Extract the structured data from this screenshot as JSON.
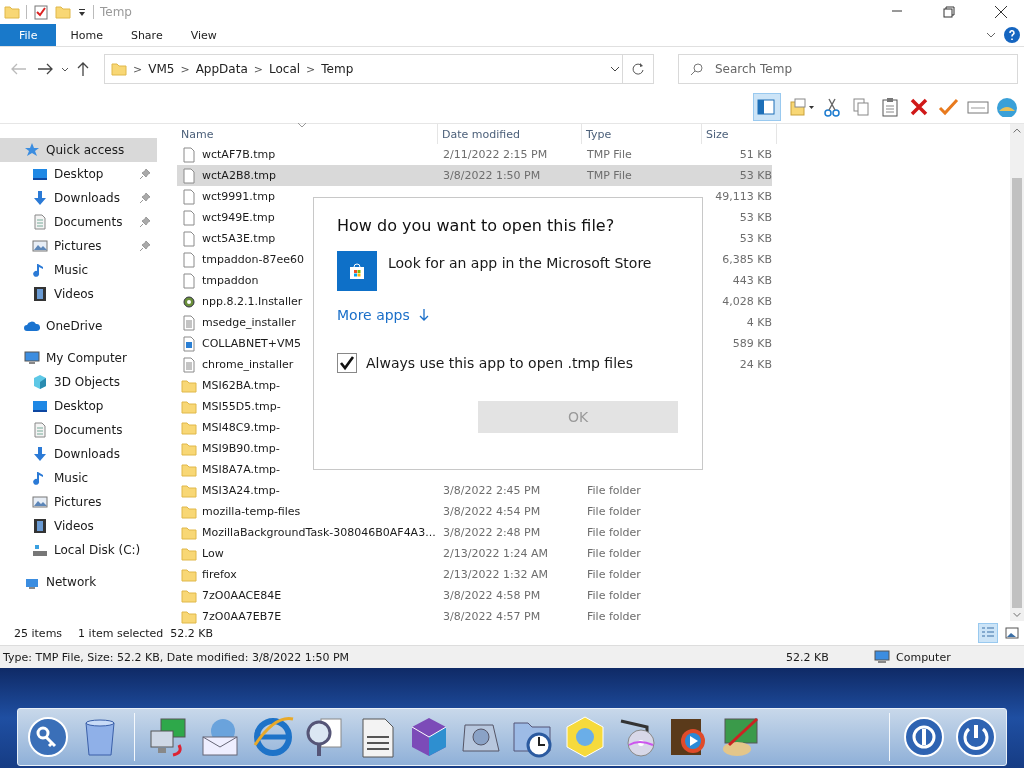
{
  "window": {
    "title": "Temp"
  },
  "ribbon_tabs": [
    {
      "label": "File",
      "kind": "file"
    },
    {
      "label": "Home",
      "kind": "plain"
    },
    {
      "label": "Share",
      "kind": "plain"
    },
    {
      "label": "View",
      "kind": "plain"
    }
  ],
  "address": {
    "path": [
      "VM5",
      "AppData",
      "Local",
      "Temp"
    ],
    "separator": ">"
  },
  "search": {
    "placeholder": "Search Temp"
  },
  "sidebar": {
    "items": [
      {
        "label": "Quick access",
        "kind": "star",
        "selected": true,
        "children": [
          {
            "label": "Desktop",
            "kind": "desktop",
            "selected": false,
            "pinned": true
          },
          {
            "label": "Downloads",
            "kind": "download",
            "selected": false,
            "pinned": true
          },
          {
            "label": "Documents",
            "kind": "document",
            "selected": false,
            "pinned": true
          },
          {
            "label": "Pictures",
            "kind": "pictures",
            "selected": false,
            "pinned": true
          },
          {
            "label": "Music",
            "kind": "music",
            "selected": false,
            "pinned": false
          },
          {
            "label": "Videos",
            "kind": "video",
            "selected": false,
            "pinned": false
          }
        ]
      },
      {
        "label": "OneDrive",
        "kind": "cloud",
        "selected": false
      },
      {
        "label": "My Computer",
        "kind": "computer",
        "selected": false,
        "children": [
          {
            "label": "3D Objects",
            "kind": "cube",
            "selected": false
          },
          {
            "label": "Desktop",
            "kind": "desktop",
            "selected": false
          },
          {
            "label": "Documents",
            "kind": "document",
            "selected": false
          },
          {
            "label": "Downloads",
            "kind": "download",
            "selected": false
          },
          {
            "label": "Music",
            "kind": "music",
            "selected": false
          },
          {
            "label": "Pictures",
            "kind": "pictures",
            "selected": false
          },
          {
            "label": "Videos",
            "kind": "video",
            "selected": false
          },
          {
            "label": "Local Disk (C:)",
            "kind": "disk",
            "selected": false
          }
        ]
      },
      {
        "label": "Network",
        "kind": "network",
        "selected": false
      }
    ]
  },
  "table": {
    "columns": [
      "Name",
      "Date modified",
      "Type",
      "Size"
    ],
    "rows": [
      {
        "name": "wctAF7B.tmp",
        "kind": "file",
        "date": "2/11/2022 2:15 PM",
        "type": "TMP File",
        "size": "51 KB",
        "selected": false
      },
      {
        "name": "wctA2B8.tmp",
        "kind": "file",
        "date": "3/8/2022 1:50 PM",
        "type": "TMP File",
        "size": "53 KB",
        "selected": true
      },
      {
        "name": "wct9991.tmp",
        "kind": "file",
        "size": "49,113 KB",
        "selected": false
      },
      {
        "name": "wct949E.tmp",
        "kind": "file",
        "size": "53 KB",
        "selected": false
      },
      {
        "name": "wct5A3E.tmp",
        "kind": "file",
        "size": "53 KB",
        "selected": false
      },
      {
        "name": "tmpaddon-87ee60",
        "kind": "file",
        "size": "6,385 KB",
        "selected": false
      },
      {
        "name": "tmpaddon",
        "kind": "file",
        "size": "443 KB",
        "selected": false
      },
      {
        "name": "npp.8.2.1.Installer",
        "kind": "installer",
        "size": "4,028 KB",
        "selected": false
      },
      {
        "name": "msedge_installer",
        "kind": "text",
        "size": "4 KB",
        "selected": false
      },
      {
        "name": "COLLABNET+VM5",
        "kind": "image",
        "size": "589 KB",
        "selected": false
      },
      {
        "name": "chrome_installer",
        "kind": "text",
        "size": "24 KB",
        "selected": false
      },
      {
        "name": "MSI62BA.tmp-",
        "kind": "folder",
        "selected": false
      },
      {
        "name": "MSI55D5.tmp-",
        "kind": "folder",
        "selected": false
      },
      {
        "name": "MSI48C9.tmp-",
        "kind": "folder",
        "selected": false
      },
      {
        "name": "MSI9B90.tmp-",
        "kind": "folder",
        "selected": false
      },
      {
        "name": "MSI8A7A.tmp-",
        "kind": "folder",
        "selected": false
      },
      {
        "name": "MSI3A24.tmp-",
        "kind": "folder",
        "date": "3/8/2022 2:45 PM",
        "type": "File folder",
        "selected": false
      },
      {
        "name": "mozilla-temp-files",
        "kind": "folder",
        "date": "3/8/2022 4:54 PM",
        "type": "File folder",
        "selected": false
      },
      {
        "name": "MozillaBackgroundTask-308046B0AF4A3...",
        "kind": "folder",
        "date": "3/8/2022 2:48 PM",
        "type": "File folder",
        "selected": false
      },
      {
        "name": "Low",
        "kind": "folder",
        "date": "2/13/2022 1:24 AM",
        "type": "File folder",
        "selected": false
      },
      {
        "name": "firefox",
        "kind": "folder",
        "date": "2/13/2022 1:32 AM",
        "type": "File folder",
        "selected": false
      },
      {
        "name": "7zO0AACE84E",
        "kind": "folder",
        "date": "3/8/2022 4:58 PM",
        "type": "File folder",
        "selected": false
      },
      {
        "name": "7zO0AA7EB7E",
        "kind": "folder",
        "date": "3/8/2022 4:57 PM",
        "type": "File folder",
        "selected": false
      }
    ]
  },
  "status_bar": {
    "items": "25 items",
    "selection": "1 item selected",
    "selection_size": "52.2 KB"
  },
  "details_bar": {
    "description": "Type: TMP File, Size: 52.2 KB, Date modified: 3/8/2022 1:50 PM",
    "size": "52.2 KB",
    "zone": "Computer"
  },
  "dialog": {
    "title": "How do you want to open this file?",
    "option": "Look for an app in the Microsoft Store",
    "more_link": "More apps",
    "checkbox": {
      "label": "Always use this app to open .tmp files",
      "checked": true
    },
    "ok_button": {
      "label": "OK",
      "disabled": true
    }
  }
}
